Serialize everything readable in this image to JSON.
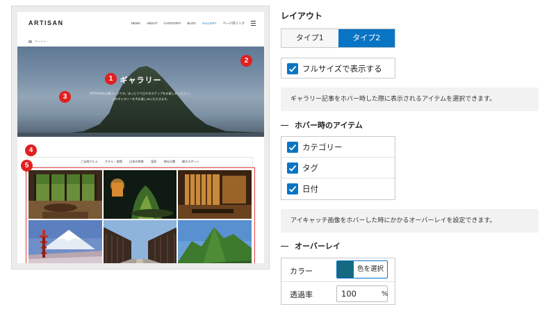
{
  "preview": {
    "logo": "ARTISAN",
    "nav": [
      "NEWS",
      "ABOUT",
      "CATEGORY",
      "BLOG",
      "GALLERY",
      "ページ内リンク"
    ],
    "nav_active_index": 4,
    "breadcrumb": "ギャラリー",
    "hero_title": "ギャラリー",
    "hero_desc_1": "ARTISANの公開ページです。ほっとりで日々のスナップをお楽しみください。",
    "hero_desc_2": "このギャラリーを今お楽しみいただきます。",
    "tabs": [
      "ご当地グルメ",
      "ホテル・旅館",
      "日本の絶景",
      "温泉",
      "神社仏閣",
      "観光スポット"
    ],
    "badges": [
      "1",
      "2",
      "3",
      "4",
      "5"
    ]
  },
  "layout_section": {
    "title": "レイアウト",
    "options": [
      "タイプ1",
      "タイプ2"
    ],
    "selected": "タイプ2",
    "fullsize_label": "フルサイズで表示する",
    "fullsize_checked": true
  },
  "hover_section": {
    "help": "ギャラリー記事をホバー時した際に表示されるアイテムを選択できます。",
    "title": "ホバー時のアイテム",
    "items": [
      {
        "label": "カテゴリー",
        "checked": true
      },
      {
        "label": "タグ",
        "checked": true
      },
      {
        "label": "日付",
        "checked": true
      }
    ]
  },
  "overlay_section": {
    "help": "アイキャッチ画像をホバーした時にかかるオーバーレイを設定できます。",
    "title": "オーバーレイ",
    "color_label": "カラー",
    "color_button": "色を選択",
    "color_value": "#156a82",
    "opacity_label": "透過率",
    "opacity_value": "100",
    "opacity_unit": "%"
  },
  "colors": {
    "accent": "#0a74c4",
    "badge": "#e02020",
    "gallery_border": "#e23b3b"
  }
}
